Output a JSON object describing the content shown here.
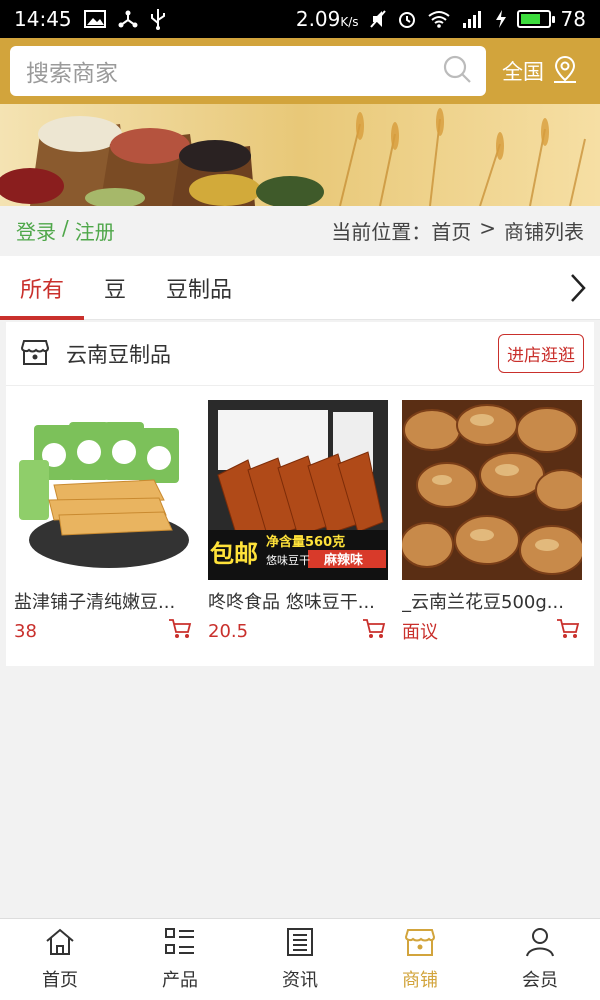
{
  "statusbar": {
    "time": "14:45",
    "speed": "2.09",
    "speed_unit": "K/s",
    "battery": "78",
    "battery_level": 0.78
  },
  "search": {
    "placeholder": "搜索商家"
  },
  "region": {
    "label": "全国"
  },
  "auth": {
    "login": "登录",
    "sep": "/",
    "register": "注册"
  },
  "breadcrumb": {
    "prefix": "当前位置：",
    "home": "首页",
    "sep": ">",
    "current": "商铺列表"
  },
  "tabs": [
    "所有",
    "豆",
    "豆制品"
  ],
  "shop": {
    "name": "云南豆制品",
    "enter_label": "进店逛逛",
    "products": [
      {
        "name": "盐津铺子清纯嫩豆...",
        "price": "38"
      },
      {
        "name": "咚咚食品 悠味豆干...",
        "price": "20.5",
        "overlay": {
          "badge": "包邮",
          "net": "净含量560克",
          "sub": "悠味豆干",
          "flavor": "麻辣味"
        }
      },
      {
        "name": "_云南兰花豆500g...",
        "price": "面议"
      }
    ]
  },
  "nav": [
    {
      "label": "首页",
      "icon": "home-icon"
    },
    {
      "label": "产品",
      "icon": "list-icon"
    },
    {
      "label": "资讯",
      "icon": "news-icon"
    },
    {
      "label": "商铺",
      "icon": "shop-icon",
      "active": true
    },
    {
      "label": "会员",
      "icon": "user-icon"
    }
  ],
  "colors": {
    "header": "#d2a43c",
    "accent_red": "#c9302c",
    "green": "#4fa74a"
  }
}
